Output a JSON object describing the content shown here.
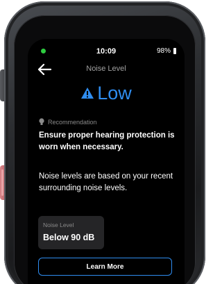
{
  "status_bar": {
    "time": "10:09",
    "battery": "98%",
    "indicator_color": "#2ecc40"
  },
  "header": {
    "title": "Noise Level",
    "back_icon": "back-arrow-icon"
  },
  "level": {
    "icon": "warning-triangle-icon",
    "text": "Low",
    "color": "#2f8df0"
  },
  "recommendation": {
    "icon": "lightbulb-icon",
    "label": "Recommendation",
    "main": "Ensure proper hearing protection is worn when necessary.",
    "body": "Noise levels are based on your recent surrounding noise levels."
  },
  "noise_card": {
    "label": "Noise Level",
    "value": "Below 90 dB"
  },
  "actions": {
    "learn_more": "Learn More"
  }
}
